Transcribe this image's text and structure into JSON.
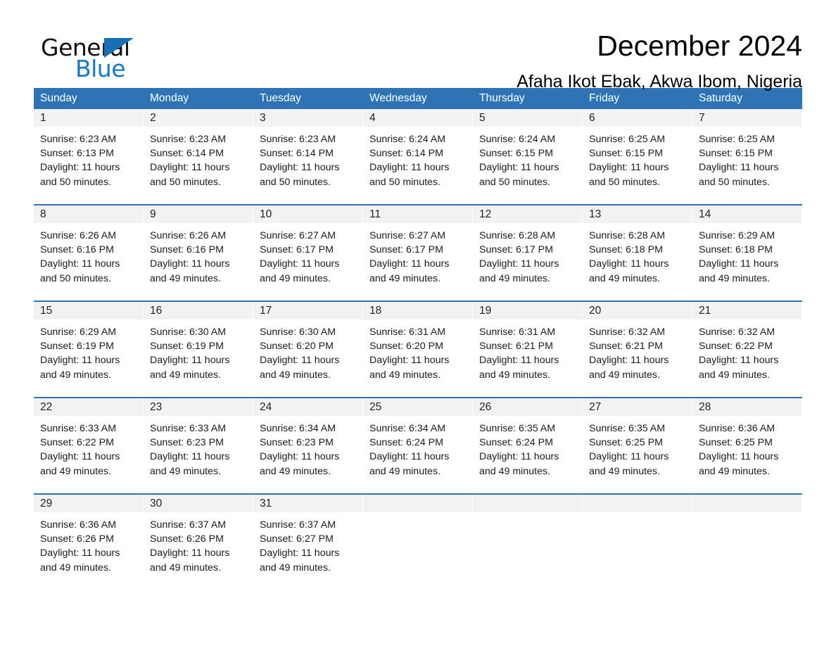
{
  "brand": {
    "name_part1": "General",
    "name_part2": "Blue",
    "triangle_color": "#1a6eb5",
    "blue_text_color": "#1877c4"
  },
  "header": {
    "title": "December 2024",
    "subtitle": "Afaha Ikot Ebak, Akwa Ibom, Nigeria"
  },
  "theme": {
    "header_blue": "#2e74b5",
    "date_band_gray": "#f2f2f2",
    "text_black": "#000000"
  },
  "calendar": {
    "weekdays": [
      "Sunday",
      "Monday",
      "Tuesday",
      "Wednesday",
      "Thursday",
      "Friday",
      "Saturday"
    ],
    "weeks": [
      [
        {
          "day": "1",
          "lines": [
            "Sunrise: 6:23 AM",
            "Sunset: 6:13 PM",
            "Daylight: 11 hours",
            "and 50 minutes."
          ]
        },
        {
          "day": "2",
          "lines": [
            "Sunrise: 6:23 AM",
            "Sunset: 6:14 PM",
            "Daylight: 11 hours",
            "and 50 minutes."
          ]
        },
        {
          "day": "3",
          "lines": [
            "Sunrise: 6:23 AM",
            "Sunset: 6:14 PM",
            "Daylight: 11 hours",
            "and 50 minutes."
          ]
        },
        {
          "day": "4",
          "lines": [
            "Sunrise: 6:24 AM",
            "Sunset: 6:14 PM",
            "Daylight: 11 hours",
            "and 50 minutes."
          ]
        },
        {
          "day": "5",
          "lines": [
            "Sunrise: 6:24 AM",
            "Sunset: 6:15 PM",
            "Daylight: 11 hours",
            "and 50 minutes."
          ]
        },
        {
          "day": "6",
          "lines": [
            "Sunrise: 6:25 AM",
            "Sunset: 6:15 PM",
            "Daylight: 11 hours",
            "and 50 minutes."
          ]
        },
        {
          "day": "7",
          "lines": [
            "Sunrise: 6:25 AM",
            "Sunset: 6:15 PM",
            "Daylight: 11 hours",
            "and 50 minutes."
          ]
        }
      ],
      [
        {
          "day": "8",
          "lines": [
            "Sunrise: 6:26 AM",
            "Sunset: 6:16 PM",
            "Daylight: 11 hours",
            "and 50 minutes."
          ]
        },
        {
          "day": "9",
          "lines": [
            "Sunrise: 6:26 AM",
            "Sunset: 6:16 PM",
            "Daylight: 11 hours",
            "and 49 minutes."
          ]
        },
        {
          "day": "10",
          "lines": [
            "Sunrise: 6:27 AM",
            "Sunset: 6:17 PM",
            "Daylight: 11 hours",
            "and 49 minutes."
          ]
        },
        {
          "day": "11",
          "lines": [
            "Sunrise: 6:27 AM",
            "Sunset: 6:17 PM",
            "Daylight: 11 hours",
            "and 49 minutes."
          ]
        },
        {
          "day": "12",
          "lines": [
            "Sunrise: 6:28 AM",
            "Sunset: 6:17 PM",
            "Daylight: 11 hours",
            "and 49 minutes."
          ]
        },
        {
          "day": "13",
          "lines": [
            "Sunrise: 6:28 AM",
            "Sunset: 6:18 PM",
            "Daylight: 11 hours",
            "and 49 minutes."
          ]
        },
        {
          "day": "14",
          "lines": [
            "Sunrise: 6:29 AM",
            "Sunset: 6:18 PM",
            "Daylight: 11 hours",
            "and 49 minutes."
          ]
        }
      ],
      [
        {
          "day": "15",
          "lines": [
            "Sunrise: 6:29 AM",
            "Sunset: 6:19 PM",
            "Daylight: 11 hours",
            "and 49 minutes."
          ]
        },
        {
          "day": "16",
          "lines": [
            "Sunrise: 6:30 AM",
            "Sunset: 6:19 PM",
            "Daylight: 11 hours",
            "and 49 minutes."
          ]
        },
        {
          "day": "17",
          "lines": [
            "Sunrise: 6:30 AM",
            "Sunset: 6:20 PM",
            "Daylight: 11 hours",
            "and 49 minutes."
          ]
        },
        {
          "day": "18",
          "lines": [
            "Sunrise: 6:31 AM",
            "Sunset: 6:20 PM",
            "Daylight: 11 hours",
            "and 49 minutes."
          ]
        },
        {
          "day": "19",
          "lines": [
            "Sunrise: 6:31 AM",
            "Sunset: 6:21 PM",
            "Daylight: 11 hours",
            "and 49 minutes."
          ]
        },
        {
          "day": "20",
          "lines": [
            "Sunrise: 6:32 AM",
            "Sunset: 6:21 PM",
            "Daylight: 11 hours",
            "and 49 minutes."
          ]
        },
        {
          "day": "21",
          "lines": [
            "Sunrise: 6:32 AM",
            "Sunset: 6:22 PM",
            "Daylight: 11 hours",
            "and 49 minutes."
          ]
        }
      ],
      [
        {
          "day": "22",
          "lines": [
            "Sunrise: 6:33 AM",
            "Sunset: 6:22 PM",
            "Daylight: 11 hours",
            "and 49 minutes."
          ]
        },
        {
          "day": "23",
          "lines": [
            "Sunrise: 6:33 AM",
            "Sunset: 6:23 PM",
            "Daylight: 11 hours",
            "and 49 minutes."
          ]
        },
        {
          "day": "24",
          "lines": [
            "Sunrise: 6:34 AM",
            "Sunset: 6:23 PM",
            "Daylight: 11 hours",
            "and 49 minutes."
          ]
        },
        {
          "day": "25",
          "lines": [
            "Sunrise: 6:34 AM",
            "Sunset: 6:24 PM",
            "Daylight: 11 hours",
            "and 49 minutes."
          ]
        },
        {
          "day": "26",
          "lines": [
            "Sunrise: 6:35 AM",
            "Sunset: 6:24 PM",
            "Daylight: 11 hours",
            "and 49 minutes."
          ]
        },
        {
          "day": "27",
          "lines": [
            "Sunrise: 6:35 AM",
            "Sunset: 6:25 PM",
            "Daylight: 11 hours",
            "and 49 minutes."
          ]
        },
        {
          "day": "28",
          "lines": [
            "Sunrise: 6:36 AM",
            "Sunset: 6:25 PM",
            "Daylight: 11 hours",
            "and 49 minutes."
          ]
        }
      ],
      [
        {
          "day": "29",
          "lines": [
            "Sunrise: 6:36 AM",
            "Sunset: 6:26 PM",
            "Daylight: 11 hours",
            "and 49 minutes."
          ]
        },
        {
          "day": "30",
          "lines": [
            "Sunrise: 6:37 AM",
            "Sunset: 6:26 PM",
            "Daylight: 11 hours",
            "and 49 minutes."
          ]
        },
        {
          "day": "31",
          "lines": [
            "Sunrise: 6:37 AM",
            "Sunset: 6:27 PM",
            "Daylight: 11 hours",
            "and 49 minutes."
          ]
        },
        {
          "day": "",
          "lines": []
        },
        {
          "day": "",
          "lines": []
        },
        {
          "day": "",
          "lines": []
        },
        {
          "day": "",
          "lines": []
        }
      ]
    ]
  }
}
